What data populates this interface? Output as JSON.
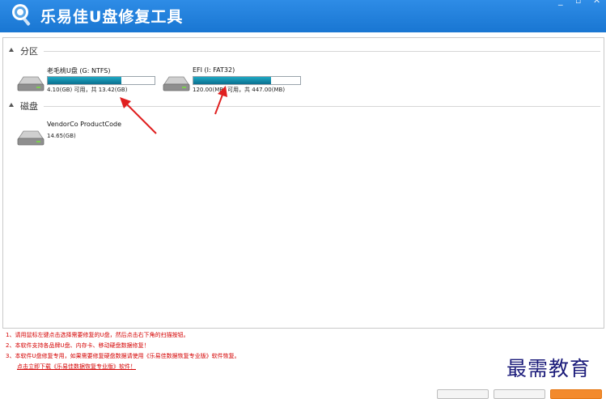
{
  "window": {
    "title": "乐易佳U盘修复工具",
    "controls": [
      "minimize",
      "maximize",
      "close"
    ]
  },
  "sections": {
    "partitions": {
      "label": "分区"
    },
    "disks": {
      "label": "磁盘"
    }
  },
  "partitions": [
    {
      "name": "老毛桃U盘 (G: NTFS)",
      "info": "4.10(GB) 可用，共 13.42(GB)",
      "used_fraction": 0.69
    },
    {
      "name": "EFI (I: FAT32)",
      "info": "120.00(MB) 可用，共 447.00(MB)",
      "used_fraction": 0.73
    }
  ],
  "disks": [
    {
      "name": "VendorCo ProductCode",
      "info": "14.65(GB)"
    }
  ],
  "notes": [
    "1、请用鼠标左键点击选择需要修复的U盘，然后点击右下角的扫描按钮。",
    "2、本软件支持各品牌U盘、内存卡、移动硬盘数据修复！",
    "3、本软件U盘修复专用，如果需要修复硬盘数据请使用《乐易佳数据恢复专业版》软件恢复。"
  ],
  "download_link": "点击立即下载《乐易佳数据恢复专业版》软件！",
  "watermark": "最需教育",
  "colors": {
    "titlebar": "#1f7fe0",
    "progress_fill": "#118aa8",
    "note_text": "#d40000",
    "annotation_arrow": "#e02020",
    "primary_button": "#f38a2c"
  }
}
